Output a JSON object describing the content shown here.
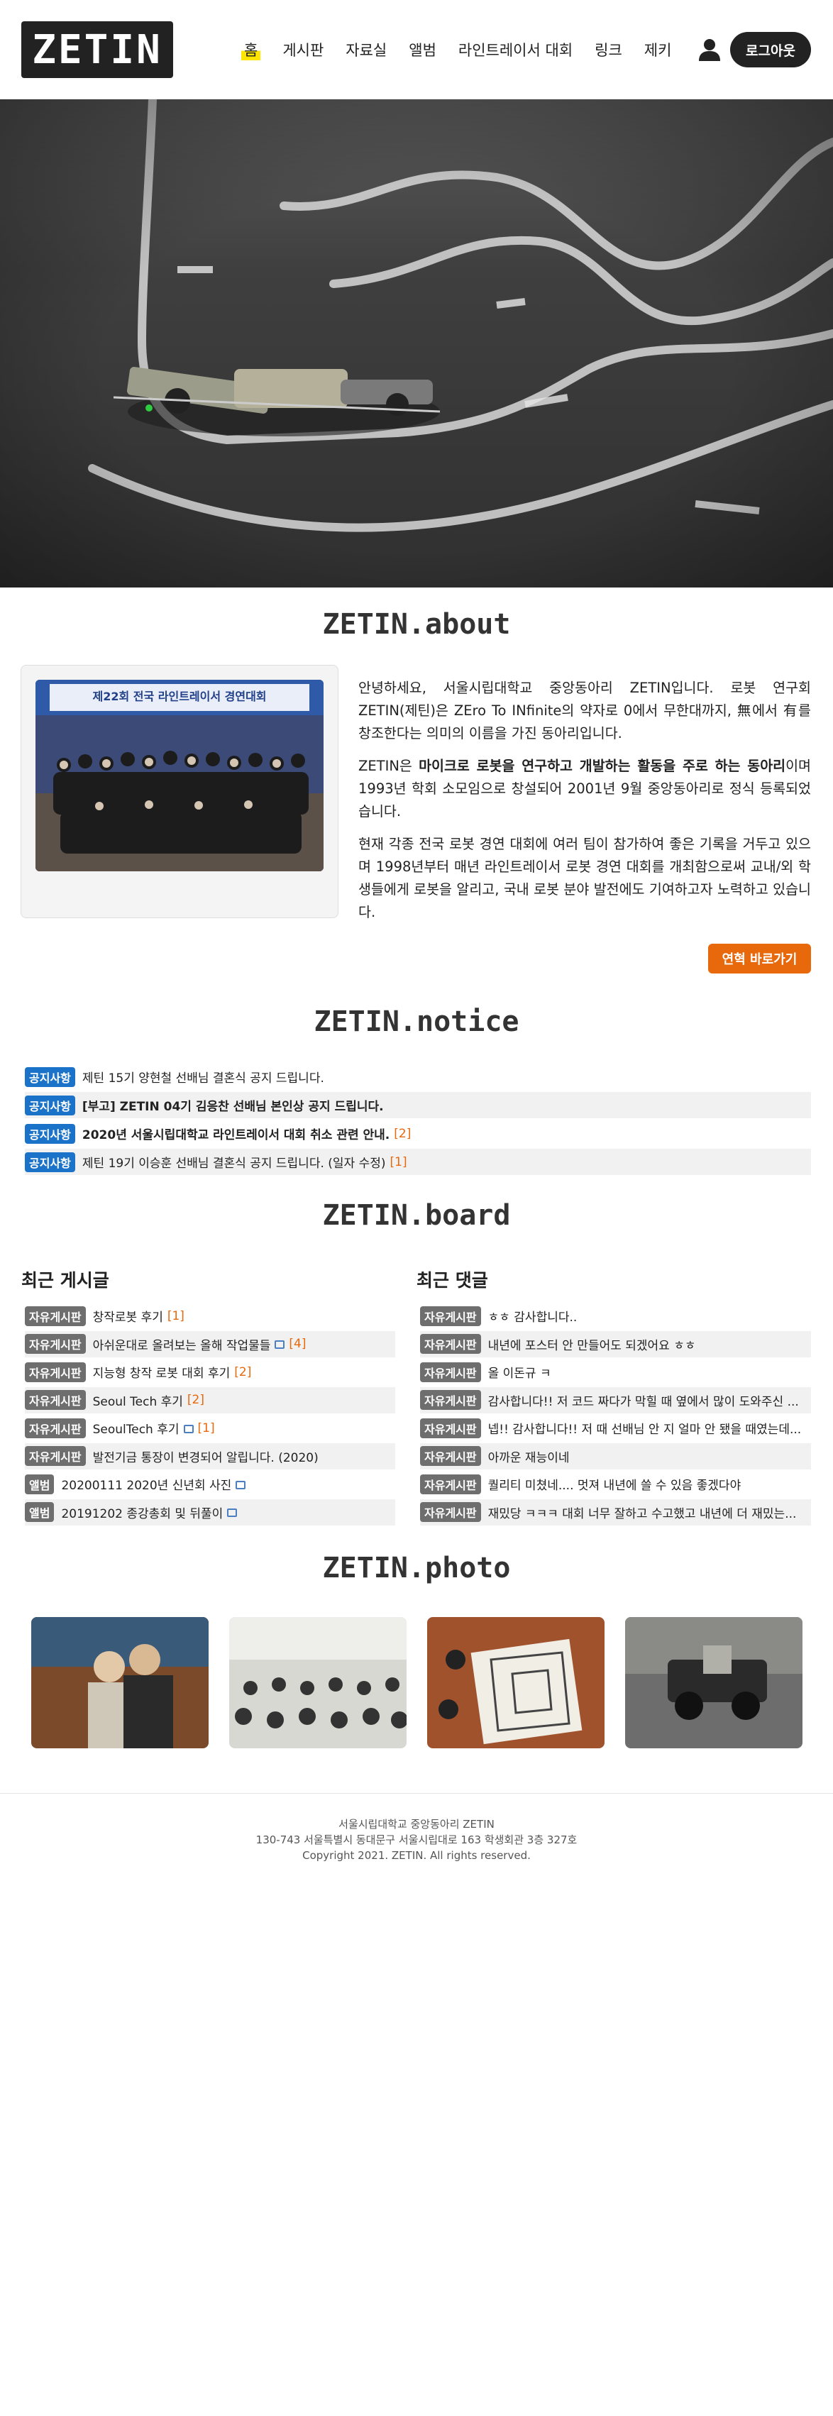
{
  "header": {
    "logo": "ZETIN",
    "nav": [
      "홈",
      "게시판",
      "자료실",
      "앨범",
      "라인트레이서 대회",
      "링크",
      "제키"
    ],
    "user_icon": "user-icon",
    "logout": "로그아웃"
  },
  "about": {
    "title": "ZETIN.about",
    "p1": "안녕하세요, 서울시립대학교 중앙동아리 ZETIN입니다. 로봇 연구회 ZETIN(제틴)은 ZEro To INfinite의 약자로 0에서 무한대까지, 無에서 有를 창조한다는 의미의 이름을 가진 동아리입니다.",
    "p2_a": "ZETIN은 ",
    "p2_b": "마이크로 로봇을 연구하고 개발하는 활동을 주로 하는 동아리",
    "p2_c": "이며 1993년 학회 소모임으로 창설되어 2001년 9월 중앙동아리로 정식 등록되었습니다.",
    "p3": "현재 각종 전국 로봇 경연 대회에 여러 팀이 참가하여 좋은 기록을 거두고 있으며 1998년부터 매년 라인트레이서 로봇 경연 대회를 개최함으로써 교내/외 학생들에게 로봇을 알리고, 국내 로봇 분야 발전에도 기여하고자 노력하고 있습니다.",
    "photo_banner": "제22회 전국 라인트레이서 경연대회",
    "button": "연혁 바로가기"
  },
  "notice": {
    "title": "ZETIN.notice",
    "items": [
      {
        "badge": "공지사항",
        "title": "제틴 15기 양현철 선배님 결혼식 공지 드립니다.",
        "count": "",
        "bold": false
      },
      {
        "badge": "공지사항",
        "title": "[부고] ZETIN 04기 김응찬 선배님 본인상 공지 드립니다.",
        "count": "",
        "bold": true
      },
      {
        "badge": "공지사항",
        "title": "2020년 서울시립대학교 라인트레이서 대회 취소 관련 안내.",
        "count": "[2]",
        "bold": true
      },
      {
        "badge": "공지사항",
        "title": "제틴 19기 이승훈 선배님 결혼식 공지 드립니다. (일자 수정)",
        "count": "[1]",
        "bold": false
      }
    ]
  },
  "board": {
    "title": "ZETIN.board",
    "recent_posts_title": "최근 게시글",
    "recent_comments_title": "최근 댓글",
    "posts": [
      {
        "badge": "자유게시판",
        "title": "창작로봇 후기",
        "count": "[1]",
        "image": false
      },
      {
        "badge": "자유게시판",
        "title": "아쉬운대로 올려보는 올해 작업물들",
        "count": "[4]",
        "image": true
      },
      {
        "badge": "자유게시판",
        "title": "지능형 창작 로봇 대회 후기",
        "count": "[2]",
        "image": false
      },
      {
        "badge": "자유게시판",
        "title": "Seoul Tech 후기",
        "count": "[2]",
        "image": false
      },
      {
        "badge": "자유게시판",
        "title": "SeoulTech 후기",
        "count": "[1]",
        "image": true
      },
      {
        "badge": "자유게시판",
        "title": "발전기금 통장이 변경되어 알립니다. (2020)",
        "count": "",
        "image": false
      },
      {
        "badge": "앨범",
        "title": "20200111 2020년 신년회 사진",
        "count": "",
        "image": true
      },
      {
        "badge": "앨범",
        "title": "20191202 종강총회 및 뒤풀이",
        "count": "",
        "image": true
      }
    ],
    "comments": [
      {
        "badge": "자유게시판",
        "title": "ㅎㅎ 감사합니다.."
      },
      {
        "badge": "자유게시판",
        "title": "내년에 포스터 안 만들어도 되겠어요 ㅎㅎ"
      },
      {
        "badge": "자유게시판",
        "title": "올 이돈규 ㅋ"
      },
      {
        "badge": "자유게시판",
        "title": "감사합니다!! 저 코드 짜다가 막힐 때 옆에서 많이 도와주신 ..."
      },
      {
        "badge": "자유게시판",
        "title": "넵!! 감사합니다!! 저 때 선배님 안 지 얼마 안 됐을 때였는데..."
      },
      {
        "badge": "자유게시판",
        "title": "아까운 재능이네"
      },
      {
        "badge": "자유게시판",
        "title": "퀄리티 미쳤네.... 멋져 내년에 쓸 수 있음 좋겠다야"
      },
      {
        "badge": "자유게시판",
        "title": "재밌당 ㅋㅋㅋ 대회 너무 잘하고 수고했고 내년에 더 재밌는..."
      }
    ]
  },
  "photo": {
    "title": "ZETIN.photo"
  },
  "footer": {
    "line1": "서울시립대학교 중앙동아리 ZETIN",
    "line2": "130-743 서울특별시 동대문구 서울시립대로 163 학생회관 3층 327호",
    "line3": "Copyright 2021. ZETIN. All rights reserved."
  },
  "colors": {
    "accent_orange": "#e8680c",
    "notice_badge": "#1a73c9",
    "board_badge": "#6e6e6e",
    "nav_highlight": "#ffe500",
    "dark": "#222222"
  }
}
